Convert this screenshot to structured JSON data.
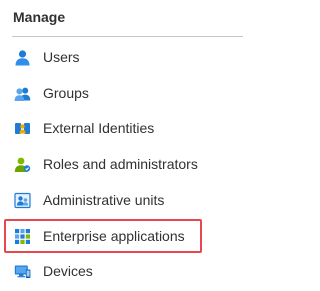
{
  "section": {
    "title": "Manage"
  },
  "nav": {
    "items": [
      {
        "label": "Users",
        "icon": "user-icon"
      },
      {
        "label": "Groups",
        "icon": "groups-icon"
      },
      {
        "label": "External Identities",
        "icon": "external-identities-icon"
      },
      {
        "label": "Roles and administrators",
        "icon": "roles-icon"
      },
      {
        "label": "Administrative units",
        "icon": "admin-units-icon"
      },
      {
        "label": "Enterprise applications",
        "icon": "enterprise-apps-icon",
        "highlighted": true
      },
      {
        "label": "Devices",
        "icon": "devices-icon"
      }
    ]
  },
  "colors": {
    "highlight_border": "#e8474f",
    "icon_blue": "#1f7bd6",
    "icon_green": "#7fba00",
    "text": "#323130"
  }
}
